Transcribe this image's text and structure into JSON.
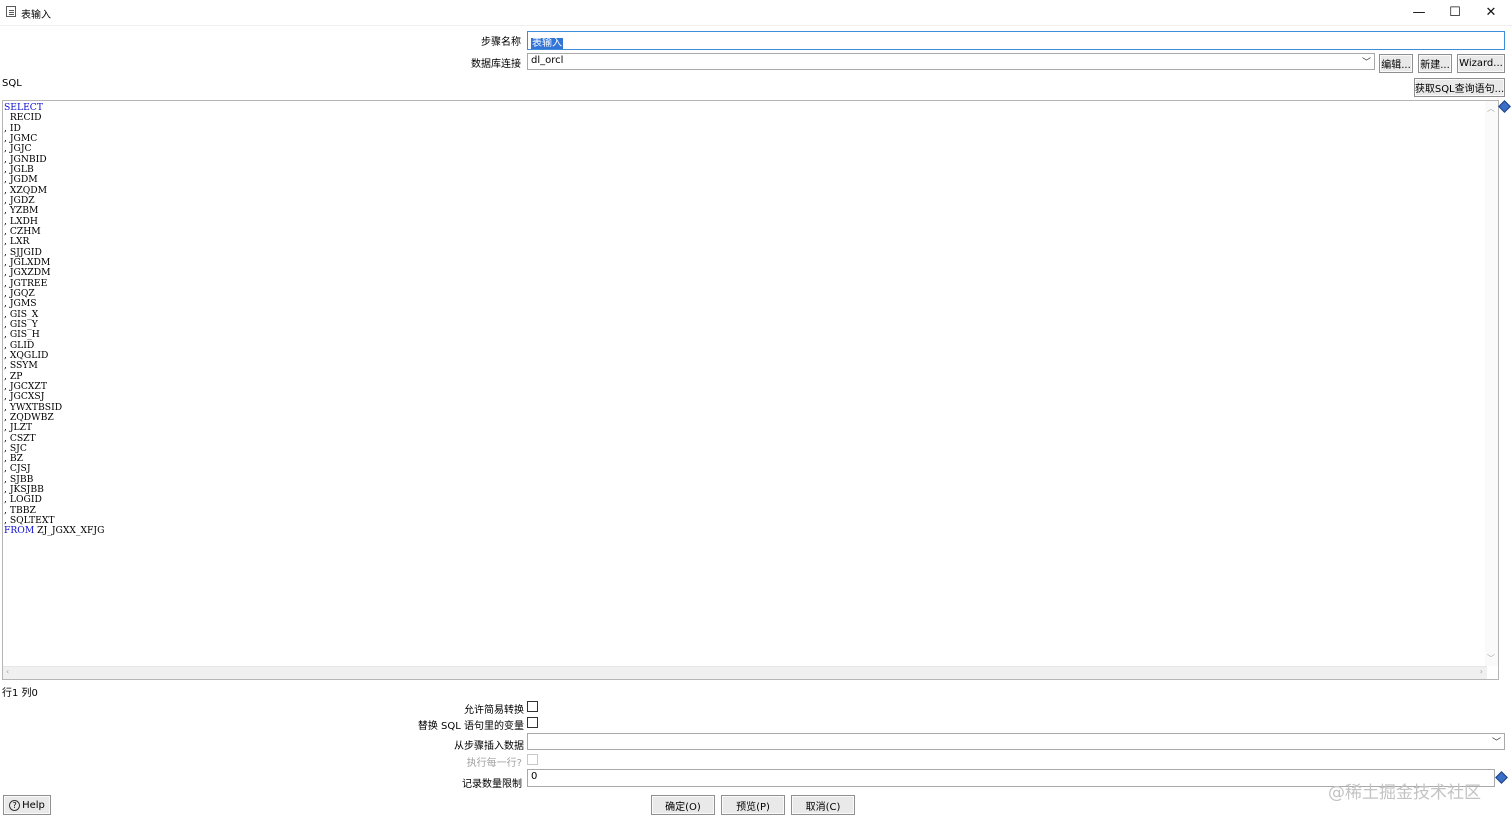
{
  "window": {
    "title": "表输入",
    "minimize_glyph": "—",
    "maximize_glyph": "☐",
    "close_glyph": "✕"
  },
  "form": {
    "step_name_label": "步骤名称",
    "step_name_value": "表输入",
    "db_connection_label": "数据库连接",
    "db_connection_value": "dl_orcl",
    "edit_button": "编辑...",
    "new_button": "新建...",
    "wizard_button": "Wizard...",
    "sql_label": "SQL",
    "get_sql_button": "获取SQL查询语句..."
  },
  "sql": {
    "select_keyword": "SELECT",
    "from_keyword": "FROM",
    "first_column": "  RECID",
    "columns": [
      "ID",
      "JGMC",
      "JGJC",
      "JGNBID",
      "JGLB",
      "JGDM",
      "XZQDM",
      "JGDZ",
      "YZBM",
      "LXDH",
      "CZHM",
      "LXR",
      "SJJGID",
      "JGLXDM",
      "JGXZDM",
      "JGTREE",
      "JGQZ",
      "JGMS",
      "GIS_X",
      "GIS_Y",
      "GIS_H",
      "GLID",
      "XQGLID",
      "SSYM",
      "ZP",
      "JGCXZT",
      "JGCXSJ",
      "YWXTBSID",
      "ZQDWBZ",
      "JLZT",
      "CSZT",
      "SJC",
      "BZ",
      "CJSJ",
      "SJBB",
      "JKSJBB",
      "LOGID",
      "TBBZ",
      "SQLTEXT"
    ],
    "table_name": " ZJ_JGXX_XFJG"
  },
  "status": {
    "cursor_position": "行1 列0"
  },
  "options": {
    "lazy_conversion_label": "允许简易转换",
    "replace_variables_label": "替换 SQL 语句里的变量",
    "insert_from_step_label": "从步骤插入数据",
    "insert_from_step_value": "",
    "execute_each_row_label": "执行每一行?",
    "limit_label": "记录数量限制",
    "limit_value": "0"
  },
  "footer": {
    "help_button": "Help",
    "ok_button": "确定(O)",
    "preview_button": "预览(P)",
    "cancel_button": "取消(C)"
  },
  "watermark": "@稀土掘金技术社区",
  "colors": {
    "keyword": "#1010d0",
    "selection": "#3375d7",
    "focus_border": "#3c8ddc"
  }
}
